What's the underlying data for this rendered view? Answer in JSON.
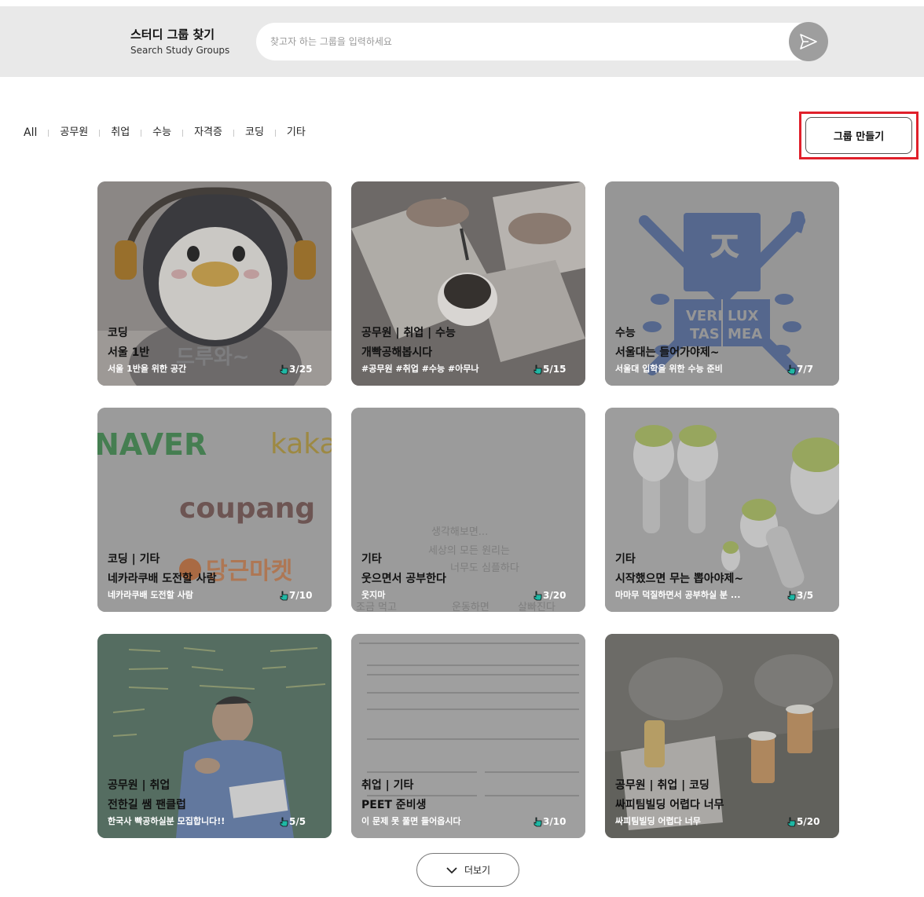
{
  "header": {
    "title": "스터디 그룹 찾기",
    "subtitle": "Search Study Groups",
    "search_placeholder": "찾고자 하는 그룹을 입력하세요",
    "search_icon": "send-icon"
  },
  "tabs": [
    "All",
    "공무원",
    "취업",
    "수능",
    "자격증",
    "코딩",
    "기타"
  ],
  "create_button": "그룹 만들기",
  "cards": [
    {
      "category": "코딩",
      "name": "서울 1반",
      "desc": "서울 1반을 위한 공간",
      "count": "3/25",
      "image": "penguin-mascot-photo"
    },
    {
      "category": "공무원 | 취업 | 수능",
      "name": "개빡공해봅시다",
      "desc": "#공무원 #취업 #수능 #아무나",
      "count": "5/15",
      "image": "desk-books-coffee-photo"
    },
    {
      "category": "수능",
      "name": "서울대는 들어가야제~",
      "desc": "서울대 입학을 위한 수능 준비",
      "count": "7/7",
      "image": "university-emblem",
      "emblem_text": [
        "VERI",
        "LUX",
        "TAS",
        "MEA"
      ]
    },
    {
      "category": "코딩 | 기타",
      "name": "네카라쿠배 도전할 사람",
      "desc": "네카라쿠배 도전할 사람",
      "count": "7/10",
      "image": "company-logos",
      "logo_texts": [
        "NAVER",
        "kaka",
        "coupang",
        "당근마켓"
      ]
    },
    {
      "category": "기타",
      "name": "웃으면서 공부한다",
      "desc": "웃지마",
      "count": "3/20",
      "image": "handwritten-note",
      "note_lines": [
        "생각해보면...",
        "세상의 모든 원리는",
        "너무도 심플하다",
        "조금 먹고",
        "운동하면",
        "살빠진다"
      ]
    },
    {
      "category": "기타",
      "name": "시작했으면 무는 뽑아야제~",
      "desc": "마마무 덕질하면서 공부하실 분 ...",
      "count": "3/5",
      "image": "radish-lightsticks-photo"
    },
    {
      "category": "공무원 | 취업",
      "name": "전한길 쌤 팬클럽",
      "desc": "한국사 빡공하실분 모집합니다!!",
      "count": "5/5",
      "image": "teacher-chalkboard-photo"
    },
    {
      "category": "취업 | 기타",
      "name": "PEET 준비생",
      "desc": "이 문제 못 풀면 들어옵시다",
      "count": "3/10",
      "image": "chemistry-exam-sheet"
    },
    {
      "category": "공무원 | 취업 | 코딩",
      "name": "싸피팀빌딩 어렵다 너무",
      "desc": "싸피팀빌딩 어렵다 너무",
      "count": "5/20",
      "image": "students-coffee-photo"
    }
  ],
  "more_button": "더보기",
  "colors": {
    "highlight": "#e0202b",
    "header_bg": "#e9e9e9",
    "card_overlay": "#9c9c9c",
    "hand_icon": "#1fb8a5"
  }
}
